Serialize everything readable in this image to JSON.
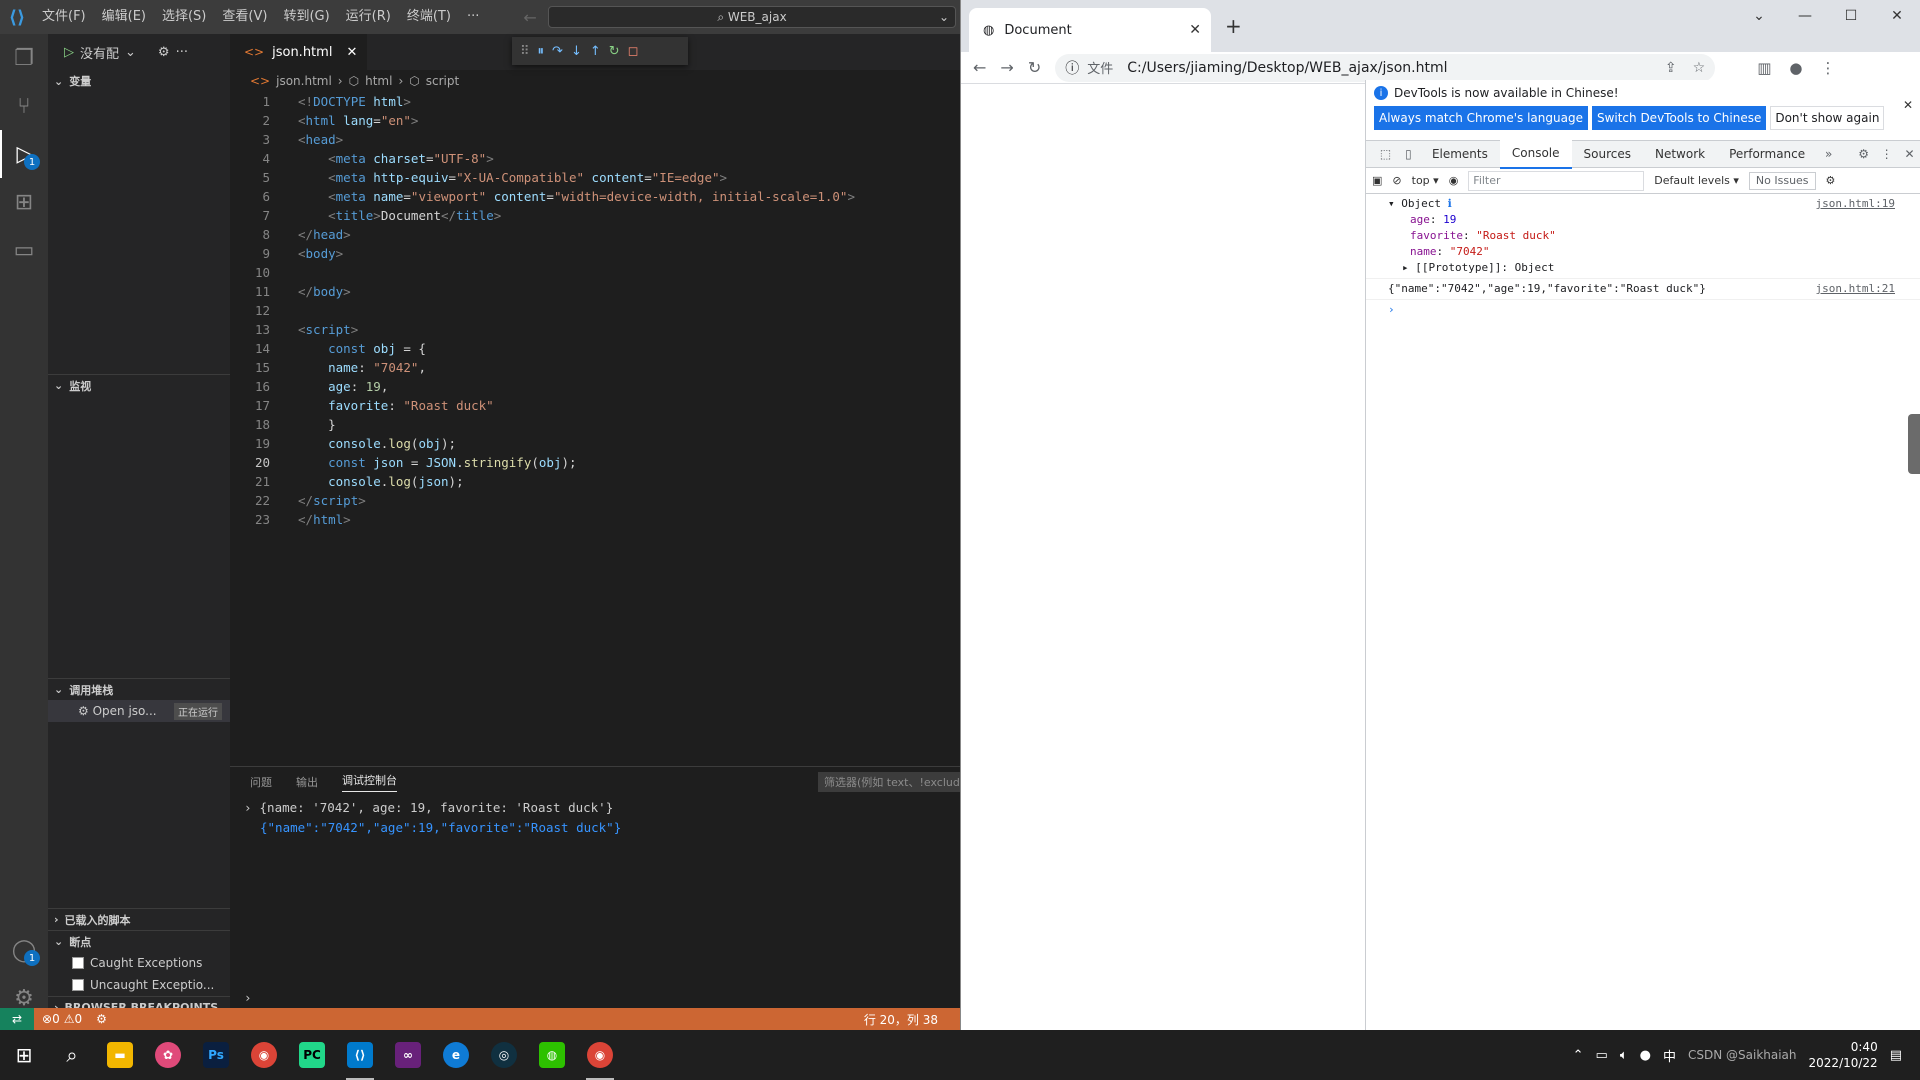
{
  "vscode": {
    "menu": [
      "文件(F)",
      "编辑(E)",
      "选择(S)",
      "查看(V)",
      "转到(G)",
      "运行(R)",
      "终端(T)",
      "···"
    ],
    "command_center": "WEB_ajax",
    "run_config": "没有配",
    "sections": {
      "variables": "变量",
      "watch": "监视",
      "call_stack": "调用堆栈",
      "loaded_scripts": "已载入的脚本",
      "breakpoints": "断点",
      "browser_breakpoints": "BROWSER BREAKPOINTS"
    },
    "call_stack_item": {
      "label": "Open jso...",
      "status": "正在运行"
    },
    "breakpoint_items": [
      "Caught Exceptions",
      "Uncaught Exceptio..."
    ],
    "tab": "json.html",
    "breadcrumb": [
      "json.html",
      "html",
      "script"
    ],
    "current_line": 20,
    "panel_tabs": [
      "问题",
      "输出",
      "调试控制台"
    ],
    "panel_filter": "筛选器(例如 text、!exclude)",
    "console_lines": [
      "{name: '7042', age: 19, favorite: 'Roast duck'}",
      "{\"name\":\"7042\",\"age\":19,\"favorite\":\"Roast duck\"}"
    ],
    "status": {
      "errors": "0",
      "warnings": "0",
      "position": "行 20，列 38"
    },
    "activity_badge": "1",
    "account_badge": "1"
  },
  "chrome": {
    "tab_title": "Document",
    "url_label": "文件",
    "url": "C:/Users/jiaming/Desktop/WEB_ajax/json.html",
    "devtools": {
      "info_message": "DevTools is now available in Chinese!",
      "buttons": [
        "Always match Chrome's language",
        "Switch DevTools to Chinese",
        "Don't show again"
      ],
      "tabs": [
        "Elements",
        "Console",
        "Sources",
        "Network",
        "Performance"
      ],
      "context": "top",
      "filter_placeholder": "Filter",
      "levels": "Default levels",
      "issues": "No Issues",
      "log1": {
        "header": "Object",
        "source": "json.html:19",
        "age_key": "age",
        "age_val": "19",
        "fav_key": "favorite",
        "fav_val": "\"Roast duck\"",
        "name_key": "name",
        "name_val": "\"7042\"",
        "proto": "[[Prototype]]: Object"
      },
      "log2": {
        "text": "{\"name\":\"7042\",\"age\":19,\"favorite\":\"Roast duck\"}",
        "source": "json.html:21"
      }
    }
  },
  "taskbar": {
    "time": "0:40",
    "date": "2022/10/22",
    "ime": "中",
    "watermark": "CSDN @Saikhaiah"
  }
}
